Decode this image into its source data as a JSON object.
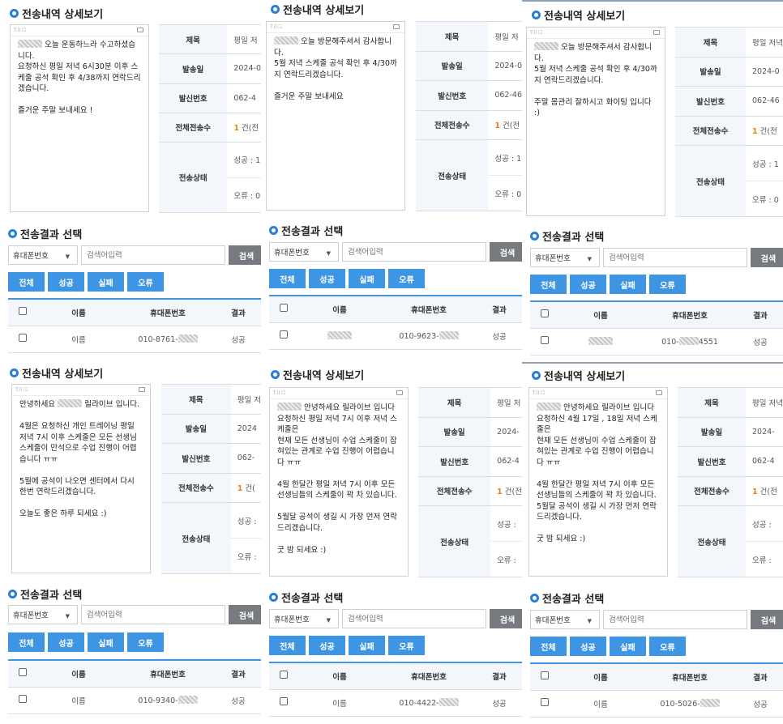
{
  "labels": {
    "detail_title": "전송내역 상세보기",
    "result_title": "전송결과 선택",
    "phone_status": "T.il ☐",
    "subject": "제목",
    "send_date": "발송일",
    "sender_number": "발신번호",
    "total_count": "전체전송수",
    "send_status": "전송상태",
    "select_value": "휴대폰번호",
    "search_placeholder": "검색어입력",
    "search_button": "검색",
    "filter_all": "전체",
    "filter_success": "성공",
    "filter_fail": "실패",
    "filter_error": "오류",
    "col_name": "이름",
    "col_phone": "휴대폰번호",
    "col_result": "결과"
  },
  "colors": {
    "accent": "#3e95e3",
    "search_button": "#777b80",
    "count": "#e8830b"
  },
  "panels": [
    {
      "message_before": "",
      "message_after": " 오늘 운동하느라 수고하셨습니다.\n요청하신 평일 저녁 6시30분 이후 스케줄 공석 확인 후 4/38까지 연락드리겠습니다.\n\n즐거운 주말 보내세요 !",
      "subject": "평일 저",
      "date": "2024-0",
      "sender": "062-4",
      "count_num": "1",
      "count_unit": " 건(전",
      "success": "성공 : 1",
      "error": "오류 : 0",
      "row_name": "이름",
      "phone_prefix": "010-8761-",
      "phone_suffix": "",
      "result": "성공"
    },
    {
      "message_before": "",
      "message_after": " 오늘 방문해주셔서 감사합니다.\n5월 저녁 스케줄 공석 확인 후 4/30까지 연락드리겠습니다.\n\n즐거운 주말 보내세요",
      "subject": "평일 저",
      "date": "2024-0",
      "sender": "062-46",
      "count_num": "1",
      "count_unit": " 건(전",
      "success": "성공 : 1",
      "error": "오류 : 0",
      "row_name": "",
      "phone_prefix": "010-9623-",
      "phone_suffix": "",
      "result": "성공"
    },
    {
      "message_before": "",
      "message_after": " 오늘 방문해주셔서 감사합니다.\n5월 저녁 스케줄 공석 확인 후 4/30까지 연락드리겠습니다.\n\n주말 몸관리 잘하시고 화이팅 입니다 :)",
      "subject": "평일 저녁",
      "date": "2024-0",
      "sender": "062-46",
      "count_num": "1",
      "count_unit": " 건(전",
      "success": "성공 : 1",
      "error": "오류 : 0",
      "row_name": "",
      "phone_prefix": "010-",
      "phone_suffix": "4551",
      "result": "성공"
    },
    {
      "message_before": "안녕하세요 ",
      "message_after": " 릴라이브 입니다.\n\n4월은 요청하신 개인 트레이닝 평일 저녁 7시 이후 스케줄은 모든 선생님 스케줄이 만석으로 수업 진행이 어렵습니다 ㅠㅠ\n\n5월에 공석이 나오면 센터에서 다시 한번 연락드리겠습니다.\n\n오늘도 좋은 하루 되세요 :)",
      "subject": "평일 저",
      "date": "2024",
      "sender": "062-",
      "count_num": "1",
      "count_unit": " 건(",
      "success": "성공 :",
      "error": "오류 :",
      "row_name": "이름",
      "phone_prefix": "010-9340-",
      "phone_suffix": "",
      "result": "성공"
    },
    {
      "message_before": "",
      "message_after": " 안녕하세요 릴라이브 입니다\n요청하신 평일 저녁 7시 이후 저녁 스케줄은\n현재 모든 선생님이 수업 스케줄이 잡혀있는 관계로 수업 진행이 어렵습니다 ㅠㅠ\n\n4월 한달간 평일 저녁 7시 이후 모든 선생님들의 스케줄이 꽉 차 있습니다.\n\n5월달 공석이 생길 시 가장 먼저 연락드리겠습니다.\n\n굿 밤 되세요 :)",
      "subject": "평일 저",
      "date": "2024-",
      "sender": "062-4",
      "count_num": "1",
      "count_unit": " 건(전",
      "success": "성공 :",
      "error": "오류 :",
      "row_name": "이름",
      "phone_prefix": "010-4422-",
      "phone_suffix": "",
      "result": "성공"
    },
    {
      "message_before": "",
      "message_after": " 안녕하세요 릴라이브 입니다\n요청하신 4월 17일 , 18일 저녁 스케줄은\n현재 모든 선생님이 수업 스케줄이 잡혀있는 관계로 수업 진행이 어렵습니다 ㅠㅠ\n\n4월 한달간 평일 저녁 7시 이후 모든 선생님들의 스케줄이 꽉 차 있습니다.\n5월달 공석이 생길 시 가장 먼저 연락드리겠습니다.\n\n굿 밤 되세요 :)",
      "subject": "평일 저녁",
      "date": "2024-",
      "sender": "062-4",
      "count_num": "1",
      "count_unit": " 건(전",
      "success": "성공 :",
      "error": "오류 :",
      "row_name": "이름",
      "phone_prefix": "010-5026-",
      "phone_suffix": "",
      "result": "성공"
    }
  ]
}
